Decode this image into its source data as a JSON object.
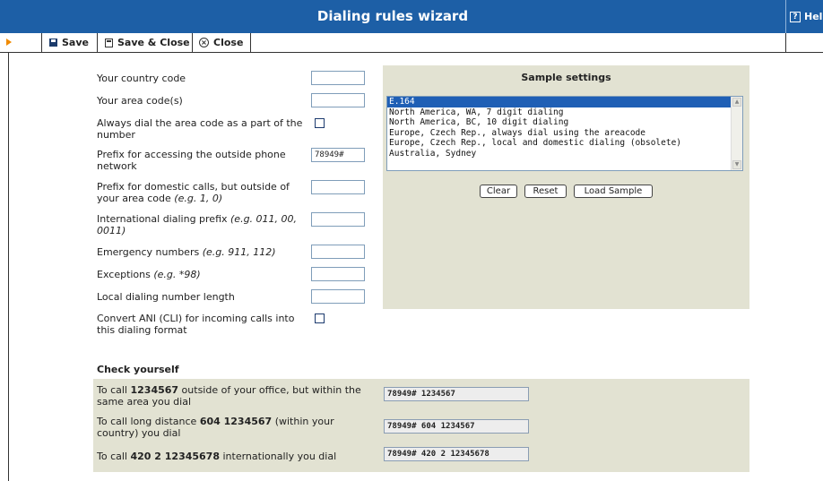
{
  "window": {
    "title": "Dialing rules wizard",
    "help_label": "Hel"
  },
  "toolbar": {
    "save": "Save",
    "save_close": "Save & Close",
    "close": "Close"
  },
  "form": {
    "country_code": {
      "label": "Your country code",
      "value": ""
    },
    "area_codes": {
      "label": "Your area code(s)",
      "value": ""
    },
    "always_dial_area": {
      "label": "Always dial the area code as a part of the number",
      "checked": false
    },
    "outside_prefix": {
      "label": "Prefix for accessing the outside phone network",
      "value": "78949#"
    },
    "domestic_prefix": {
      "label": "Prefix for domestic calls, but outside of your area code",
      "hint": "(e.g. 1, 0)",
      "value": ""
    },
    "intl_prefix": {
      "label": "International dialing prefix",
      "hint": "(e.g. 011, 00, 0011)",
      "value": ""
    },
    "emergency": {
      "label": "Emergency numbers",
      "hint": "(e.g. 911, 112)",
      "value": ""
    },
    "exceptions": {
      "label": "Exceptions",
      "hint": "(e.g. *98)",
      "value": ""
    },
    "local_length": {
      "label": "Local dialing number length",
      "value": ""
    },
    "convert_ani": {
      "label": "Convert ANI (CLI) for incoming calls into this dialing format",
      "checked": false
    }
  },
  "sample": {
    "title": "Sample settings",
    "items": [
      "E.164",
      "North America, WA, 7 digit dialing",
      "North America, BC, 10 digit dialing",
      "Europe, Czech Rep., always dial using the areacode",
      "Europe, Czech Rep., local and domestic dialing (obsolete)",
      "Australia, Sydney"
    ],
    "selected": "E.164",
    "buttons": {
      "clear": "Clear",
      "reset": "Reset",
      "load": "Load Sample"
    }
  },
  "check": {
    "heading": "Check yourself",
    "rows": [
      {
        "pre": "To call ",
        "number": "1234567",
        "post": " outside of your office, but within the same area you dial",
        "result": "78949# 1234567"
      },
      {
        "pre": "To call long distance ",
        "number": "604 1234567",
        "post": " (within your country) you dial",
        "result": "78949# 604 1234567"
      },
      {
        "pre": "To call ",
        "number": "420 2 12345678",
        "post": " internationally you dial",
        "result": "78949# 420 2 12345678"
      }
    ]
  }
}
